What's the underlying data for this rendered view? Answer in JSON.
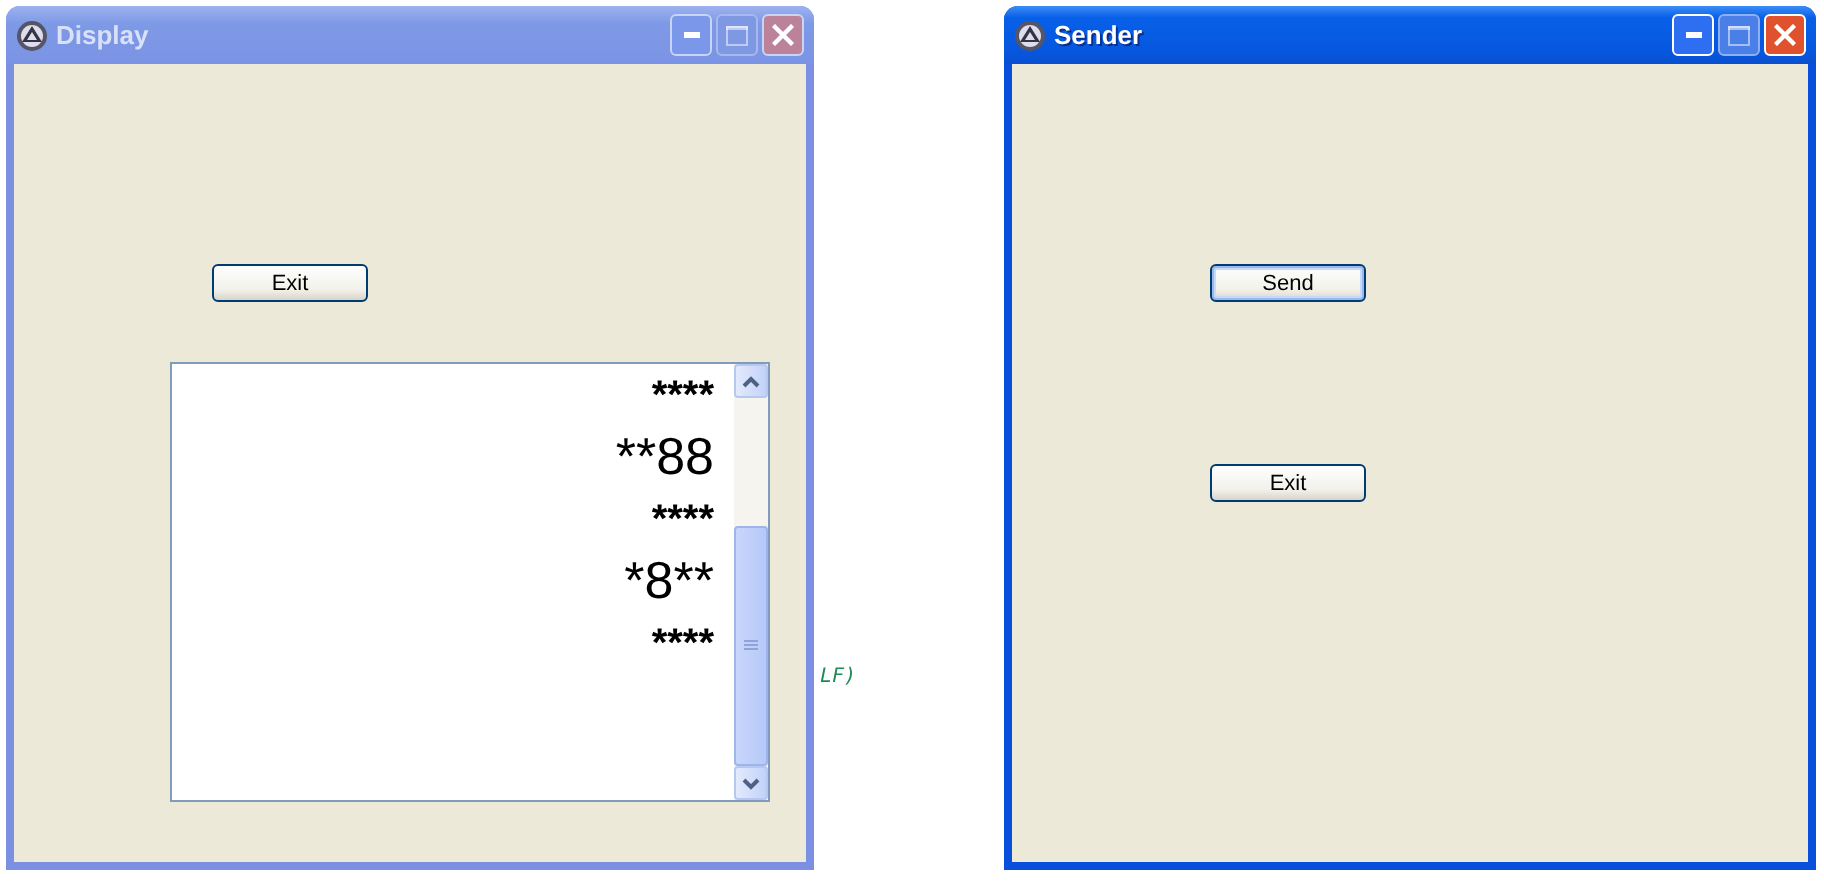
{
  "desktop": {
    "background_text": "LF)"
  },
  "windows": [
    {
      "title": "Display",
      "active": false,
      "buttons": [
        "Exit"
      ],
      "listbox": {
        "lines": [
          {
            "text": "****",
            "kind": "small"
          },
          {
            "text": "**88",
            "kind": "large"
          },
          {
            "text": "****",
            "kind": "small"
          },
          {
            "text": "*8**",
            "kind": "large"
          },
          {
            "text": "****",
            "kind": "small"
          }
        ]
      }
    },
    {
      "title": "Sender",
      "active": true,
      "buttons": [
        "Send",
        "Exit"
      ]
    }
  ]
}
